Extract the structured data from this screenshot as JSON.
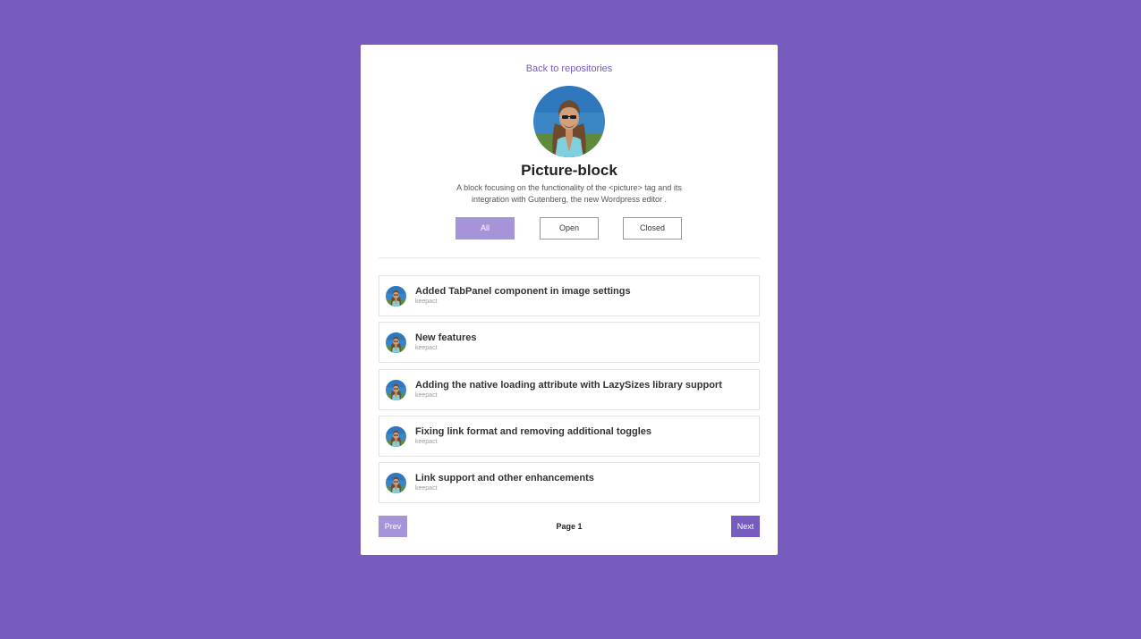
{
  "nav": {
    "back_label": "Back to repositories"
  },
  "repo": {
    "avatar_icon": "user-photo-avatar",
    "title": "Picture-block",
    "description": "A block focusing on the functionality of the <picture> tag and its integration with Gutenberg, the new Wordpress editor ."
  },
  "filters": [
    {
      "label": "All",
      "active": true
    },
    {
      "label": "Open",
      "active": false
    },
    {
      "label": "Closed",
      "active": false
    }
  ],
  "items": [
    {
      "title": "Added TabPanel component in image settings",
      "author": "keepact"
    },
    {
      "title": "New features",
      "author": "keepact"
    },
    {
      "title": "Adding the native loading attribute with LazySizes library support",
      "author": "keepact"
    },
    {
      "title": "Fixing link format and removing additional toggles",
      "author": "keepact"
    },
    {
      "title": "Link support and other enhancements",
      "author": "keepact"
    }
  ],
  "pagination": {
    "prev_label": "Prev",
    "page_label": "Page 1",
    "next_label": "Next"
  },
  "colors": {
    "background": "#775bbe",
    "accent": "#775bbe",
    "accent_light": "#a594d8"
  }
}
